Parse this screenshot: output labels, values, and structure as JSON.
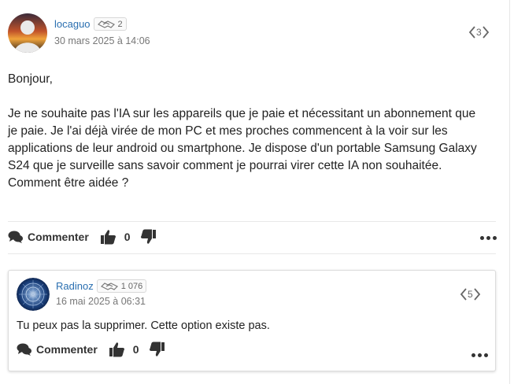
{
  "post": {
    "author": "locaguo",
    "reputation": "2",
    "date": "30 mars 2025 à 14:06",
    "nav_number": "3",
    "greeting": "Bonjour,",
    "body_lines": [
      "Je ne souhaite pas l'IA sur les appareils que je paie et nécessitant un abonnement que",
      "je paie. Je l'ai déjà virée de mon PC et mes proches commencent à la voir sur les",
      "applications de leur android ou smartphone. Je dispose d'un portable Samsung Galaxy",
      "S24 que je surveille sans savoir comment je pourrai virer cette IA non souhaitée.",
      "Comment être aidée ?"
    ],
    "comment_label": "Commenter",
    "like_count": "0"
  },
  "reply": {
    "author": "Radinoz",
    "reputation": "1 076",
    "date": "16 mai 2025 à 06:31",
    "nav_number": "5",
    "text": "Tu peux pas la supprimer. Cette option existe pas.",
    "comment_label": "Commenter",
    "like_count": "0"
  },
  "colors": {
    "author_link": "#2a6fb0",
    "text": "#222222",
    "muted": "#777777",
    "border": "#dcdcdc"
  },
  "icons": {
    "badge": "handshake-icon",
    "comment": "comments-icon",
    "like": "thumbs-up-icon",
    "dislike": "thumbs-down-icon",
    "more": "ellipsis-icon",
    "nav_prev": "chevron-left-icon",
    "nav_next": "chevron-right-icon"
  }
}
